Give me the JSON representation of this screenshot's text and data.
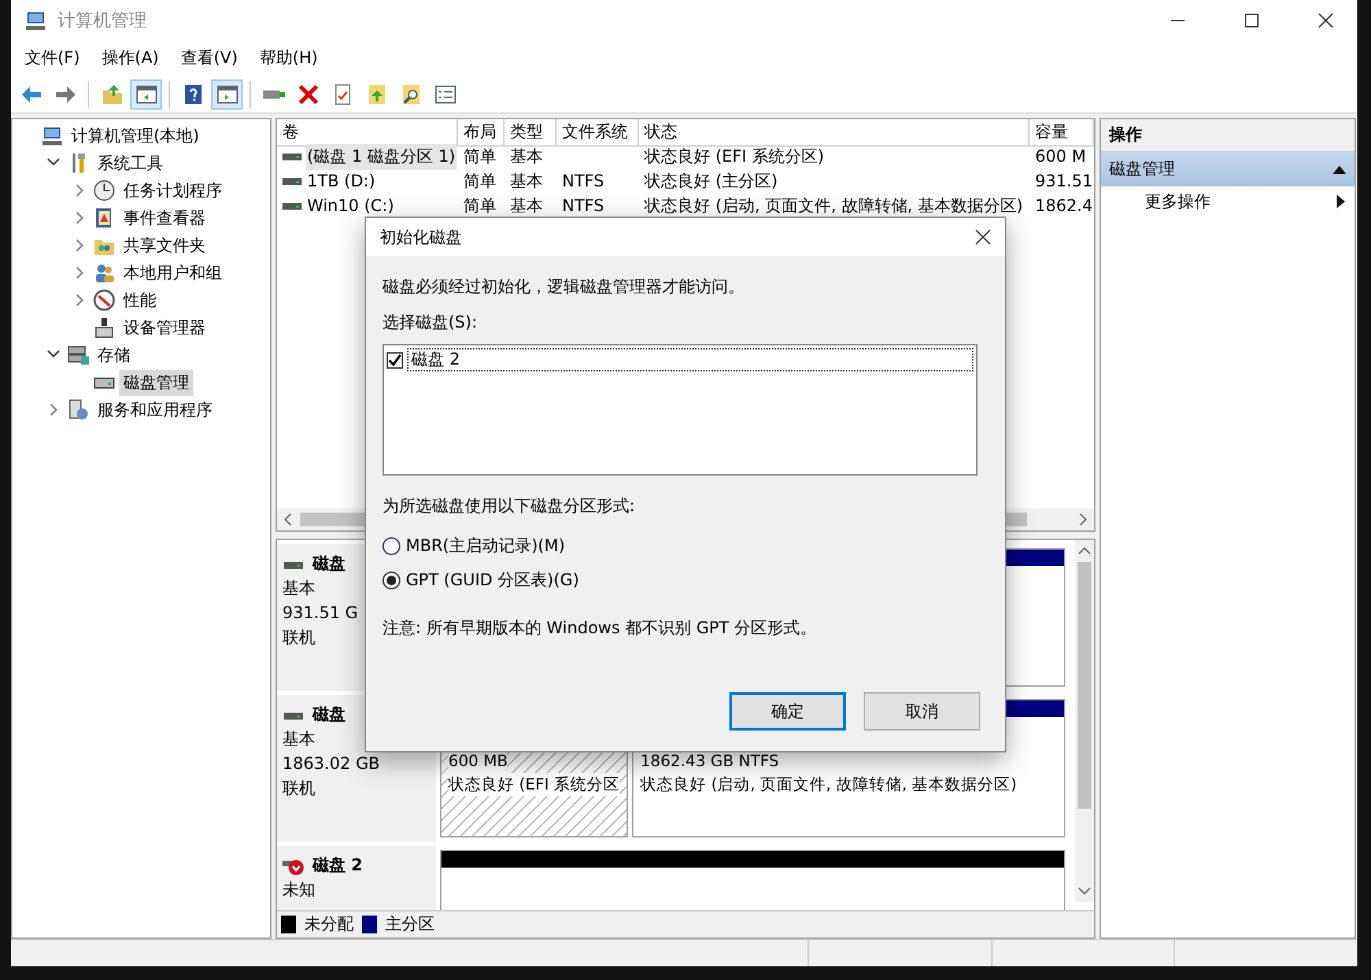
{
  "window": {
    "title": "计算机管理"
  },
  "menu": [
    "文件(F)",
    "操作(A)",
    "查看(V)",
    "帮助(H)"
  ],
  "toolbar": [
    {
      "kind": "back",
      "pressed": false
    },
    {
      "kind": "forward",
      "pressed": false
    },
    {
      "kind": "sep"
    },
    {
      "kind": "up",
      "pressed": false
    },
    {
      "kind": "tree",
      "pressed": true
    },
    {
      "kind": "sep"
    },
    {
      "kind": "help",
      "pressed": false
    },
    {
      "kind": "pane",
      "pressed": true
    },
    {
      "kind": "sep"
    },
    {
      "kind": "connect",
      "pressed": false
    },
    {
      "kind": "delete",
      "pressed": false
    },
    {
      "kind": "props",
      "pressed": false
    },
    {
      "kind": "export",
      "pressed": false
    },
    {
      "kind": "find",
      "pressed": false
    },
    {
      "kind": "list",
      "pressed": false
    }
  ],
  "tree": {
    "label": "计算机管理(本地)",
    "kind": "computer",
    "selected": false,
    "children": [
      {
        "label": "系统工具",
        "kind": "tools",
        "expanded": true,
        "selected": false,
        "children": [
          {
            "label": "任务计划程序",
            "kind": "clock",
            "expanded": false,
            "selected": false
          },
          {
            "label": "事件查看器",
            "kind": "log",
            "expanded": false,
            "selected": false
          },
          {
            "label": "共享文件夹",
            "kind": "share",
            "expanded": false,
            "selected": false
          },
          {
            "label": "本地用户和组",
            "kind": "users",
            "expanded": false,
            "selected": false
          },
          {
            "label": "性能",
            "kind": "gauge",
            "expanded": false,
            "selected": false
          },
          {
            "label": "设备管理器",
            "kind": "device",
            "selected": false
          }
        ]
      },
      {
        "label": "存储",
        "kind": "storage",
        "expanded": true,
        "selected": false,
        "children": [
          {
            "label": "磁盘管理",
            "kind": "disk",
            "selected": true
          }
        ]
      },
      {
        "label": "服务和应用程序",
        "kind": "services",
        "expanded": false,
        "selected": false
      }
    ]
  },
  "table": {
    "columns": [
      "卷",
      "布局",
      "类型",
      "文件系统",
      "状态",
      "容量"
    ],
    "rows": [
      {
        "selected": true,
        "cells": [
          "(磁盘 1 磁盘分区 1)",
          "简单",
          "基本",
          "",
          "状态良好 (EFI 系统分区)",
          "600 M"
        ]
      },
      {
        "selected": false,
        "cells": [
          "1TB (D:)",
          "简单",
          "基本",
          "NTFS",
          "状态良好 (主分区)",
          "931.51"
        ]
      },
      {
        "selected": false,
        "cells": [
          "Win10 (C:)",
          "简单",
          "基本",
          "NTFS",
          "状态良好 (启动, 页面文件, 故障转储, 基本数据分区)",
          "1862.4"
        ]
      }
    ]
  },
  "disks": [
    {
      "kind": "online",
      "name": "磁盘",
      "type": "基本",
      "size": "931.51 G",
      "status": "联机",
      "partitions": [
        {
          "color": "#000080",
          "hatched": false
        }
      ]
    },
    {
      "kind": "online",
      "name": "磁盘",
      "type": "基本",
      "size": "1863.02 GB",
      "status": "联机",
      "partitions": [
        {
          "hatched": true,
          "lines": [
            "600 MB",
            "状态良好 (EFI 系统分区"
          ]
        },
        {
          "color": "#000080",
          "hatched": false,
          "lines": [
            "1862.43 GB NTFS",
            "状态良好 (启动, 页面文件, 故障转储, 基本数据分区)"
          ]
        }
      ]
    },
    {
      "kind": "unknown",
      "name": "磁盘 2",
      "type": "未知",
      "partitions": [
        {
          "color": "#000000",
          "hatched": false
        }
      ]
    }
  ],
  "legend": [
    {
      "label": "未分配",
      "color": "#000000"
    },
    {
      "label": "主分区",
      "color": "#000080"
    }
  ],
  "actions": {
    "title": "操作",
    "section": {
      "label": "磁盘管理",
      "expanded": true
    },
    "items": [
      "更多操作"
    ]
  },
  "dialog": {
    "title": "初始化磁盘",
    "message": "磁盘必须经过初始化，逻辑磁盘管理器才能访问。",
    "list_label": "选择磁盘(S):",
    "disks": [
      {
        "label": "磁盘 2",
        "checked": true
      }
    ],
    "style_label": "为所选磁盘使用以下磁盘分区形式:",
    "options": [
      {
        "label": "MBR(主启动记录)(M)",
        "selected": false
      },
      {
        "label": "GPT (GUID 分区表)(G)",
        "selected": true
      }
    ],
    "note": "注意: 所有早期版本的 Windows 都不识别 GPT 分区形式。",
    "buttons": [
      {
        "label": "确定",
        "default": true
      },
      {
        "label": "取消",
        "default": false
      }
    ]
  }
}
